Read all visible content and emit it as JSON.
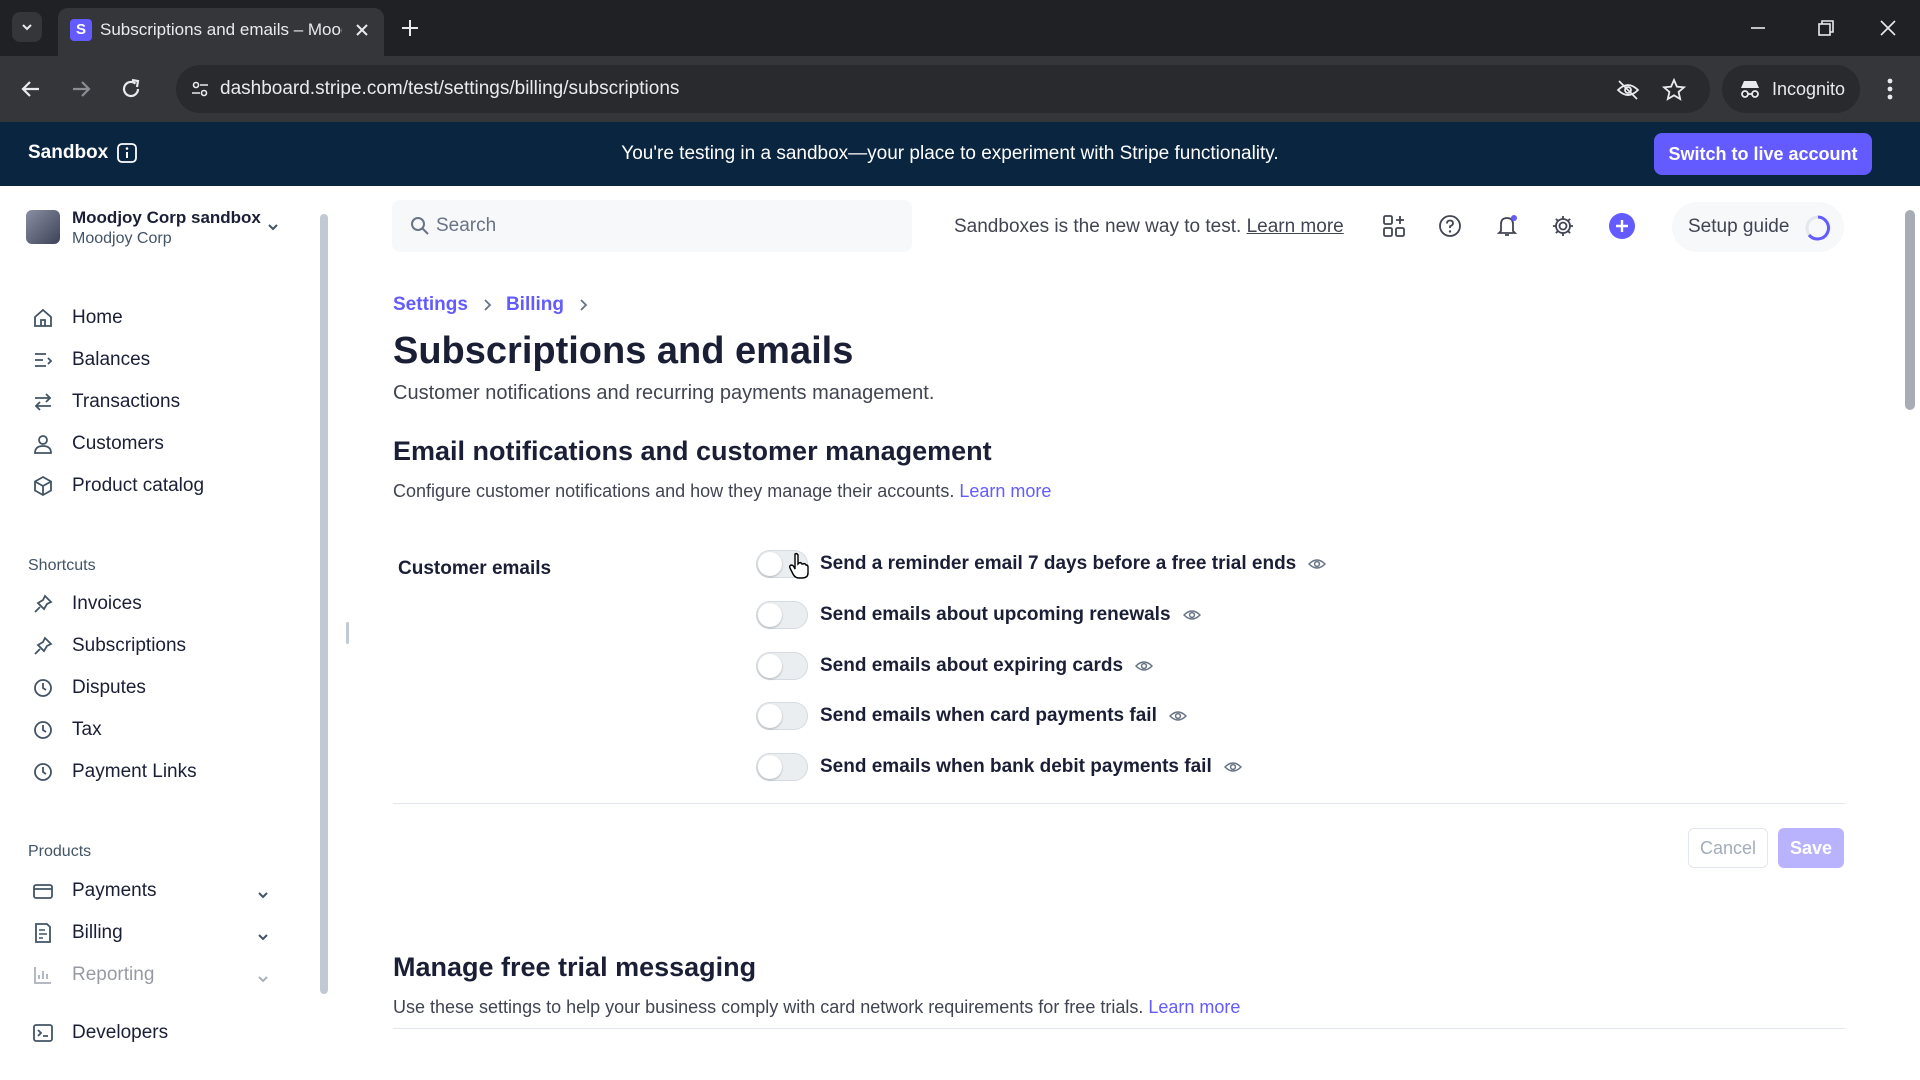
{
  "browser": {
    "tab_title": "Subscriptions and emails – Moodjoy Corp sandbox",
    "favicon_letter": "S",
    "url": "dashboard.stripe.com/test/settings/billing/subscriptions",
    "incognito_label": "Incognito"
  },
  "banner": {
    "label": "Sandbox",
    "message": "You're testing in a sandbox—your place to experiment with Stripe functionality.",
    "cta": "Switch to live account"
  },
  "account": {
    "name": "Moodjoy Corp sandbox",
    "sub": "Moodjoy Corp"
  },
  "sidebar": {
    "main": [
      {
        "label": "Home",
        "icon": "home-icon"
      },
      {
        "label": "Balances",
        "icon": "balances-icon"
      },
      {
        "label": "Transactions",
        "icon": "transactions-icon"
      },
      {
        "label": "Customers",
        "icon": "customers-icon"
      },
      {
        "label": "Product catalog",
        "icon": "product-catalog-icon"
      }
    ],
    "shortcuts_title": "Shortcuts",
    "shortcuts": [
      {
        "label": "Invoices",
        "icon": "pin-icon"
      },
      {
        "label": "Subscriptions",
        "icon": "pin-icon"
      },
      {
        "label": "Disputes",
        "icon": "clock-icon"
      },
      {
        "label": "Tax",
        "icon": "clock-icon"
      },
      {
        "label": "Payment Links",
        "icon": "clock-icon"
      }
    ],
    "products_title": "Products",
    "products": [
      {
        "label": "Payments",
        "icon": "payments-icon"
      },
      {
        "label": "Billing",
        "icon": "billing-icon"
      },
      {
        "label": "Reporting",
        "icon": "reporting-icon"
      }
    ],
    "developers": {
      "label": "Developers",
      "icon": "developers-icon"
    }
  },
  "topbar": {
    "search_placeholder": "Search",
    "sandbox_note": "Sandboxes is the new way to test.",
    "sandbox_learn_more": "Learn more",
    "setup_guide": "Setup guide"
  },
  "page": {
    "breadcrumb": [
      "Settings",
      "Billing"
    ],
    "title": "Subscriptions and emails",
    "subtitle": "Customer notifications and recurring payments management.",
    "section1": {
      "title": "Email notifications and customer management",
      "desc": "Configure customer notifications and how they manage their accounts.",
      "learn_more": "Learn more"
    },
    "customer_emails_label": "Customer emails",
    "toggles": [
      {
        "label": "Send a reminder email 7 days before a free trial ends",
        "on": false
      },
      {
        "label": "Send emails about upcoming renewals",
        "on": false
      },
      {
        "label": "Send emails about expiring cards",
        "on": false
      },
      {
        "label": "Send emails when card payments fail",
        "on": false
      },
      {
        "label": "Send emails when bank debit payments fail",
        "on": false
      }
    ],
    "cancel": "Cancel",
    "save": "Save",
    "section2": {
      "title": "Manage free trial messaging",
      "desc": "Use these settings to help your business comply with card network requirements for free trials.",
      "learn_more": "Learn more"
    }
  },
  "colors": {
    "accent": "#635bff",
    "banner_bg": "#0a2540",
    "text": "#1a1f36"
  }
}
